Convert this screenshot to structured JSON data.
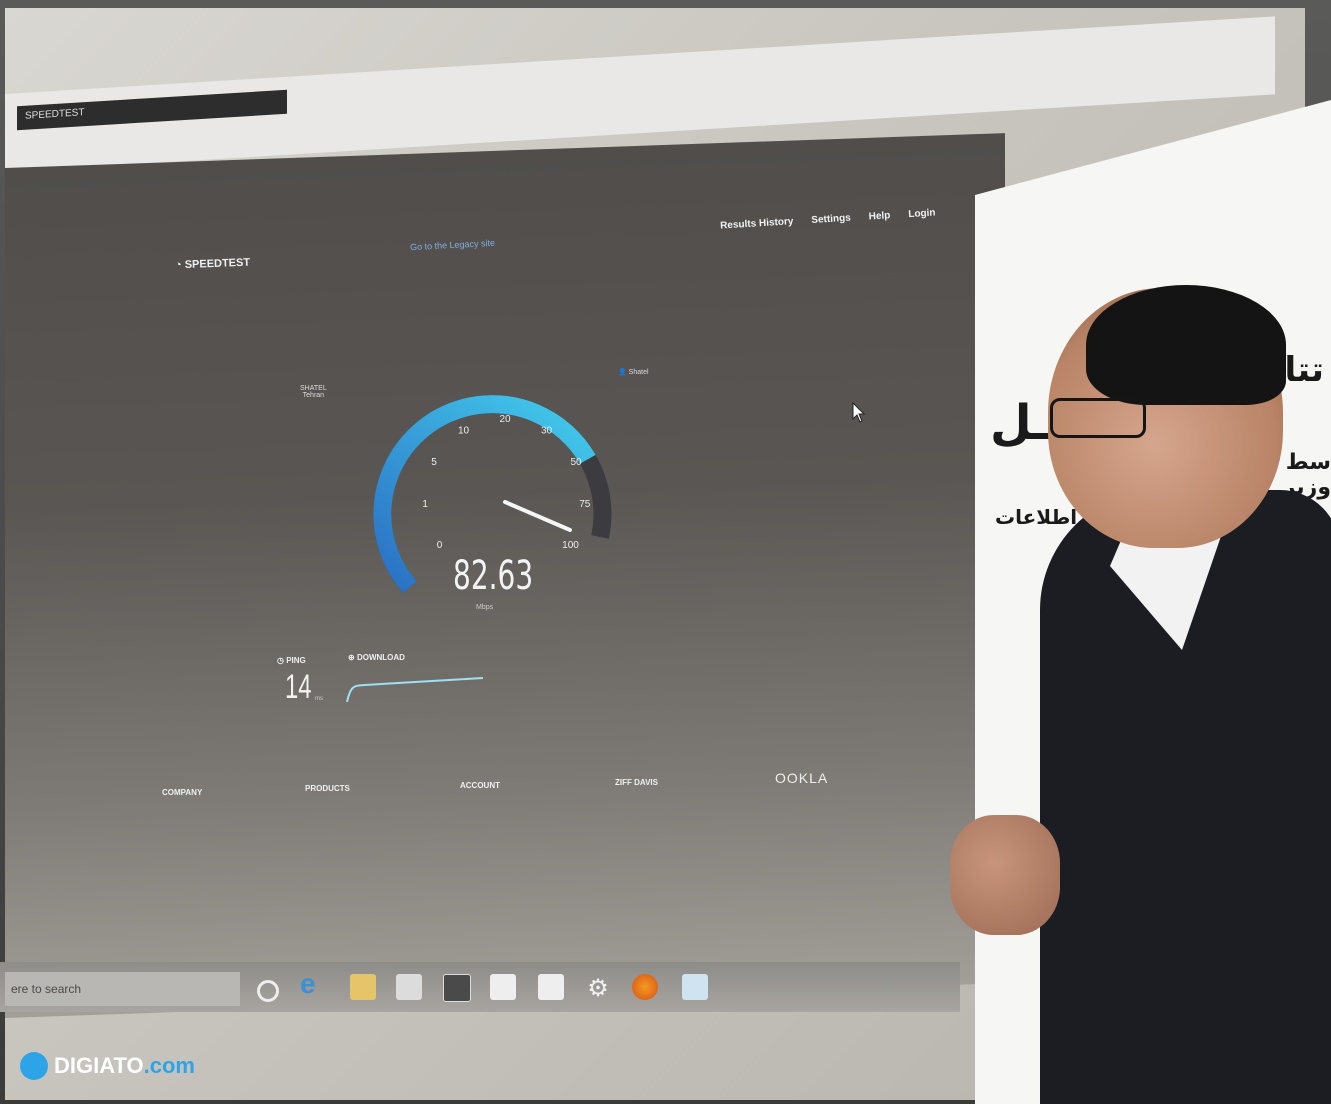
{
  "browser": {
    "tab_title": "SPEEDTEST",
    "nav": [
      "Results History",
      "Settings",
      "Help",
      "Login"
    ],
    "legacy_link": "Go to the Legacy site"
  },
  "speedtest": {
    "logo": "SPEEDTEST",
    "isp_name": "SHATEL",
    "isp_location": "Tehran",
    "server_name": "Shatel",
    "gauge_ticks": [
      "0",
      "1",
      "5",
      "10",
      "20",
      "30",
      "50",
      "75",
      "100"
    ],
    "gauge_fill_fraction": 0.82,
    "speed_value": "82.63",
    "speed_unit": "Mbps",
    "ping_label": "PING",
    "ping_value": "14",
    "ping_unit": "ms",
    "download_label": "DOWNLOAD"
  },
  "footer": {
    "columns": [
      "COMPANY",
      "PRODUCTS",
      "ACCOUNT",
      "ZIFF DAVIS"
    ],
    "brand": "OOKLA"
  },
  "taskbar": {
    "search_placeholder": "ere to search"
  },
  "banner": {
    "line1": "تتاح",
    "line2": "ـل",
    "line3": "سط وزیر",
    "line4": "اری اطلاعات"
  },
  "watermark": {
    "brand": "DIGIATO",
    "suffix": ".com"
  },
  "colors": {
    "gauge_blue": "#3a8fd9",
    "gauge_cyan": "#35c6e8",
    "watermark_blue": "#2ea4e8"
  }
}
